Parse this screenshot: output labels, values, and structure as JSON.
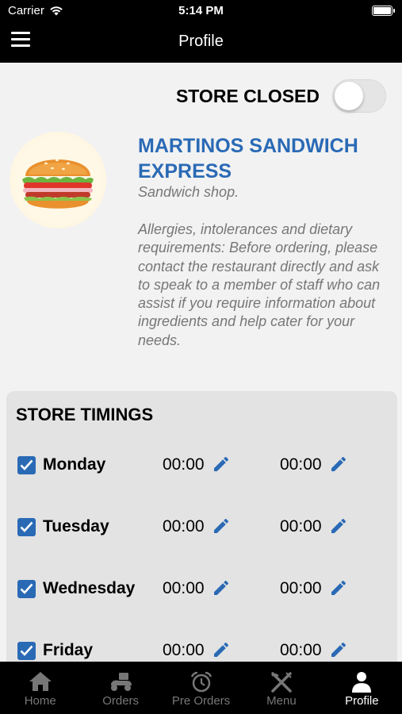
{
  "status_bar": {
    "carrier": "Carrier",
    "time": "5:14 PM"
  },
  "header": {
    "title": "Profile"
  },
  "store_status": {
    "label": "STORE CLOSED",
    "toggle_on": false
  },
  "restaurant": {
    "name": "MARTINOS SANDWICH EXPRESS",
    "type": "Sandwich shop.",
    "description": "Allergies, intolerances and dietary requirements: Before ordering, please contact the restaurant directly and ask to speak to a member of staff who can assist if you require information about ingredients and help cater for your needs."
  },
  "timings": {
    "title": "STORE TIMINGS",
    "days": [
      {
        "name": "Monday",
        "open": "00:00",
        "close": "00:00",
        "checked": true
      },
      {
        "name": "Tuesday",
        "open": "00:00",
        "close": "00:00",
        "checked": true
      },
      {
        "name": "Wednesday",
        "open": "00:00",
        "close": "00:00",
        "checked": true
      },
      {
        "name": "Friday",
        "open": "00:00",
        "close": "00:00",
        "checked": true
      }
    ]
  },
  "tabbar": {
    "items": [
      {
        "label": "Home",
        "icon": "home-icon",
        "active": false
      },
      {
        "label": "Orders",
        "icon": "scooter-icon",
        "active": false
      },
      {
        "label": "Pre Orders",
        "icon": "alarm-clock-icon",
        "active": false
      },
      {
        "label": "Menu",
        "icon": "fork-knife-icon",
        "active": false
      },
      {
        "label": "Profile",
        "icon": "person-icon",
        "active": true
      }
    ]
  },
  "colors": {
    "accent": "#2a6ab5",
    "bar": "#000000",
    "background": "#f2f2f2",
    "panel": "#e3e3e3"
  }
}
